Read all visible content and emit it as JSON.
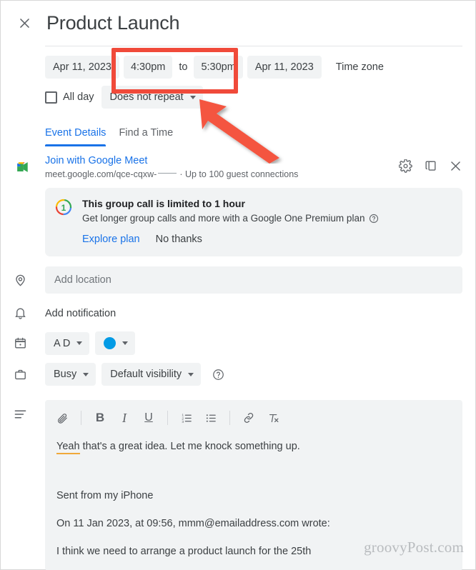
{
  "header": {
    "close_icon": "close-icon",
    "title": "Product Launch"
  },
  "datetime": {
    "start_date": "Apr 11, 2023",
    "start_time": "4:30pm",
    "to_label": "to",
    "end_time": "5:30pm",
    "end_date": "Apr 11, 2023",
    "timezone_label": "Time zone",
    "all_day_label": "All day",
    "repeat_value": "Does not repeat"
  },
  "tabs": [
    {
      "label": "Event Details",
      "active": true
    },
    {
      "label": "Find a Time",
      "active": false
    }
  ],
  "meet": {
    "logo_icon": "google-meet-icon",
    "join_label": "Join with Google Meet",
    "url": "meet.google.com/qce-cqxw-",
    "guest_info": "· Up to 100 guest connections",
    "settings_icon": "gear-icon",
    "copy_icon": "copy-icon",
    "remove_icon": "close-icon"
  },
  "promo": {
    "badge_icon": "google-one-icon",
    "title": "This group call is limited to 1 hour",
    "subtitle": "Get longer group calls and more with a Google One Premium plan",
    "help_icon": "help-circle-icon",
    "explore_label": "Explore plan",
    "dismiss_label": "No thanks"
  },
  "fields": {
    "location_icon": "location-pin-icon",
    "location_placeholder": "Add location",
    "location_value": "",
    "notification_icon": "bell-icon",
    "notification_label": "Add notification",
    "calendar_icon": "calendar-icon",
    "calendar_value": "A D",
    "color_swatch": "#039be5",
    "busy_icon": "briefcase-icon",
    "busy_value": "Busy",
    "visibility_value": "Default visibility",
    "visibility_help_icon": "help-circle-icon"
  },
  "editor": {
    "description_icon": "description-lines-icon",
    "toolbar": [
      {
        "name": "attach-icon",
        "glyph": "attach"
      },
      {
        "name": "bold-icon",
        "glyph": "B"
      },
      {
        "name": "italic-icon",
        "glyph": "I"
      },
      {
        "name": "underline-icon",
        "glyph": "U"
      },
      {
        "name": "numbered-list-icon",
        "glyph": "ol"
      },
      {
        "name": "bulleted-list-icon",
        "glyph": "ul"
      },
      {
        "name": "link-icon",
        "glyph": "link"
      },
      {
        "name": "clear-formatting-icon",
        "glyph": "clear"
      }
    ],
    "body": {
      "spell_word": "Yeah",
      "line1_rest": " that's a great idea. Let me knock something up.",
      "line2": "Sent from my iPhone",
      "line3": "On 11 Jan 2023, at 09:56, mmm@emailaddress.com wrote:",
      "line4": "I think we need to arrange a product launch for the 25th"
    }
  },
  "watermark": "groovyPost.com",
  "annotations": {
    "highlight_color": "#f04a3a",
    "highlight_target": "time-fields",
    "arrow_color": "#f4543f"
  }
}
